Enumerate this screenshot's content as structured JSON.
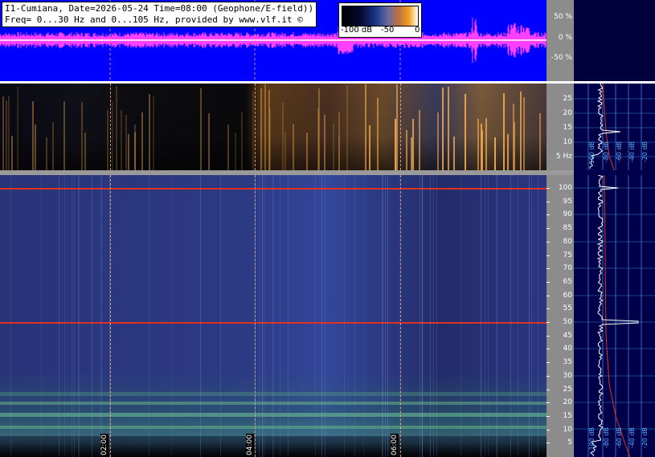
{
  "header": {
    "line1": "I1-Cumiana, Date=2026-05-24 Time=08:00 (Geophone/E-field))",
    "line2": "Freq= 0...30 Hz and 0...105 Hz, provided by www.vlf.it ©"
  },
  "colorbar": {
    "labels": [
      "-100 dB",
      "-50",
      "0"
    ]
  },
  "waveform_axis": {
    "labels": [
      "50 %",
      "0 %",
      "-50 %"
    ]
  },
  "time_labels": [
    "02:00",
    "04:00",
    "06:00"
  ],
  "low_spectrogram_axis": {
    "labels": [
      "25",
      "20",
      "15",
      "10",
      "5 Hz"
    ]
  },
  "high_spectrogram_axis": {
    "labels": [
      "100",
      "95",
      "90",
      "85",
      "80",
      "75",
      "70",
      "65",
      "60",
      "55",
      "50",
      "45",
      "40",
      "35",
      "30",
      "25",
      "20",
      "15",
      "10",
      "5"
    ]
  },
  "profile_low": {
    "db_labels": [
      "-100 dB",
      "-80 dB",
      "-60 dB",
      "-40 dB",
      "-20 dB"
    ]
  },
  "profile_high": {
    "db_labels": [
      "-100 dB",
      "-80 dB",
      "-60 dB",
      "-40 dB",
      "-20 dB"
    ]
  },
  "colors": {
    "waveform_bg": "#0000ff",
    "waveform_trace": "#ff40ff",
    "mains_line": "#e03020",
    "axis_bg": "#8c8c8c",
    "profile_bg": "#00004a",
    "profile_grid": "#3a8ad0"
  }
}
